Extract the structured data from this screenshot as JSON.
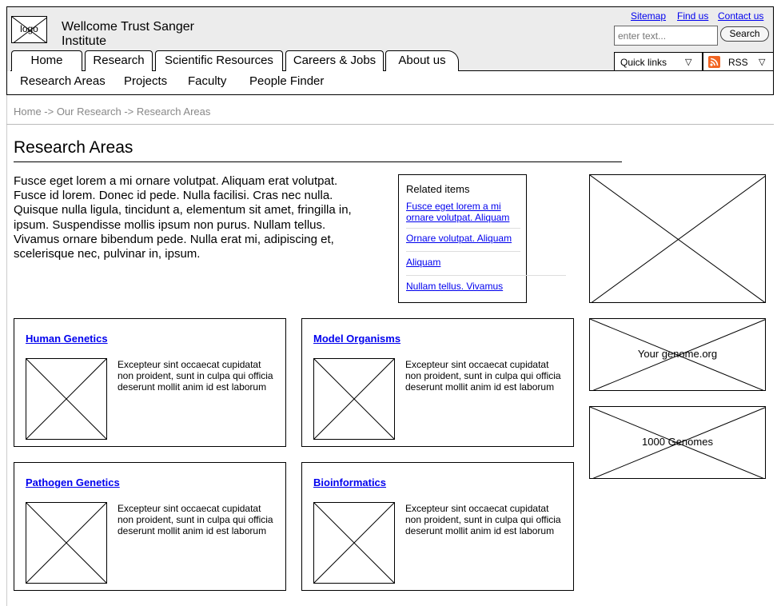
{
  "header": {
    "logo_label": "logo",
    "site_name": "Wellcome Trust Sanger Institute",
    "top_links": [
      "Sitemap",
      "Find us",
      "Contact us"
    ],
    "search": {
      "placeholder": "enter text...",
      "button_label": "Search"
    },
    "tabs": [
      "Home",
      "Research",
      "Scientific Resources",
      "Careers & Jobs",
      "About us"
    ],
    "quick_links_label": "Quick links",
    "rss_label": "RSS",
    "subnav": [
      "Research Areas",
      "Projects",
      "Faculty",
      "People Finder"
    ]
  },
  "breadcrumb": "Home -> Our Research -> Research Areas",
  "main": {
    "title": "Research Areas",
    "intro": "Fusce eget lorem a mi ornare volutpat. Aliquam erat volutpat. Fusce id lorem. Donec id pede. Nulla facilisi. Cras nec nulla. Quisque nulla ligula, tincidunt a, elementum sit amet, fringilla in, ipsum. Suspendisse mollis ipsum non purus. Nullam tellus. Vivamus ornare bibendum pede. Nulla erat mi, adipiscing et, scelerisque nec, pulvinar in, ipsum."
  },
  "related": {
    "heading": "Related items",
    "links": [
      "Fusce eget lorem a mi ornare volutpat. Aliquam",
      "Ornare volutpat. Aliquam",
      "Aliquam",
      "Nullam tellus. Vivamus"
    ]
  },
  "cards": [
    {
      "title": "Human Genetics",
      "text": "Excepteur sint occaecat cupidatat non proident, sunt in culpa qui officia deserunt mollit anim id est laborum"
    },
    {
      "title": "Model Organisms",
      "text": "Excepteur sint occaecat cupidatat non proident, sunt in culpa qui officia deserunt mollit anim id est laborum"
    },
    {
      "title": "Pathogen Genetics",
      "text": "Excepteur sint occaecat cupidatat non proident, sunt in culpa qui officia deserunt mollit anim id est laborum"
    },
    {
      "title": "Bioinformatics",
      "text": "Excepteur sint occaecat cupidatat non proident, sunt in culpa qui officia deserunt mollit anim id est laborum"
    }
  ],
  "side_promos": [
    "Your genome.org",
    "1000 Genomes"
  ],
  "colors": {
    "link": "#0000ee",
    "header_bg": "#ececec",
    "rss_icon": "#f26522"
  }
}
